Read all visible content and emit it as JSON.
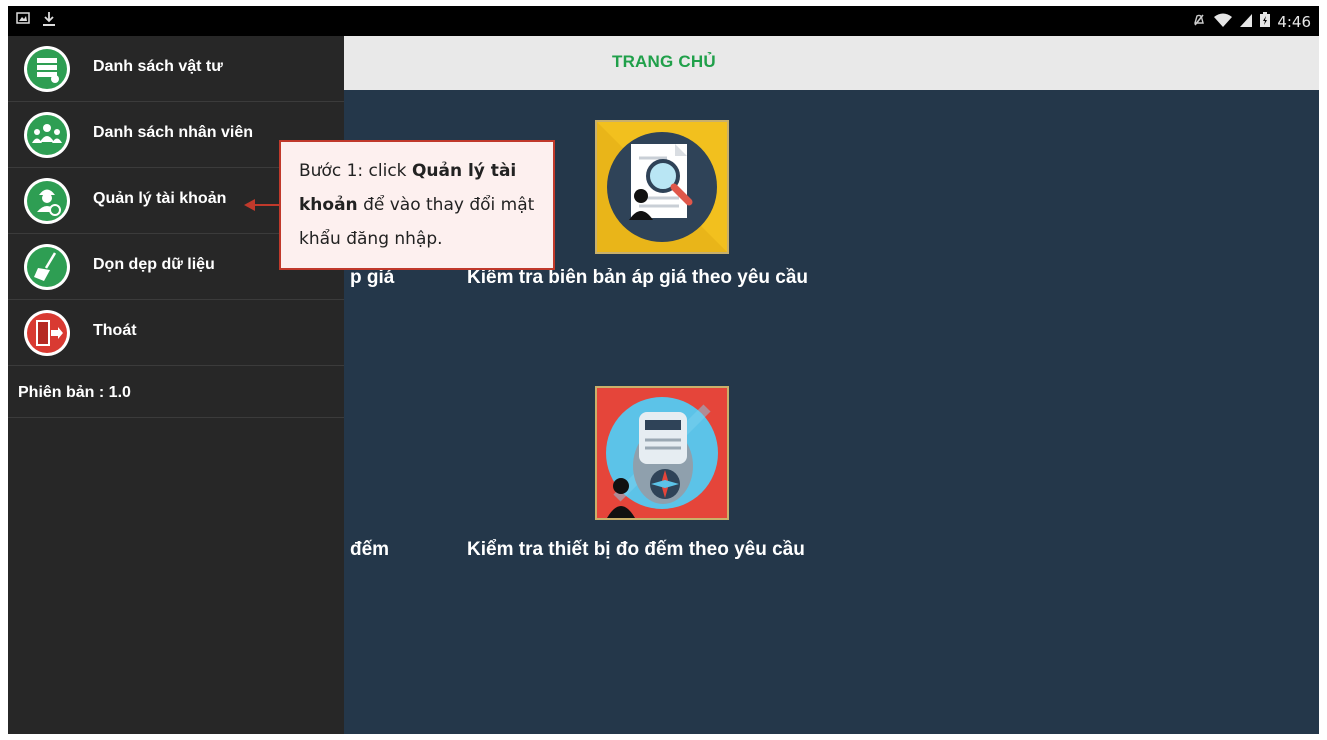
{
  "status_bar": {
    "time": "4:46"
  },
  "app_bar": {
    "title": "TRANG CHỦ"
  },
  "tiles": [
    {
      "label": "Kiểm tra biên bản áp giá theo yêu cầu",
      "icon": "document-search-icon"
    },
    {
      "label": "Kiểm tra thiết bị đo đếm theo yêu cầu",
      "icon": "electric-meter-icon"
    }
  ],
  "partial_labels": [
    "p giá",
    "đếm"
  ],
  "drawer": {
    "items": [
      {
        "label": "Danh sách vật tư",
        "icon": "materials-list-icon"
      },
      {
        "label": "Danh sách nhân viên",
        "icon": "staff-group-icon"
      },
      {
        "label": "Quản lý tài khoản",
        "icon": "account-settings-icon"
      },
      {
        "label": "Dọn dẹp dữ liệu",
        "icon": "broom-icon"
      },
      {
        "label": "Thoát",
        "icon": "exit-door-icon"
      }
    ],
    "version": "Phiên bản : 1.0"
  },
  "callout": {
    "prefix": "Bước 1: click ",
    "bold": "Quản lý tài khoản",
    "suffix": " để vào thay đổi mật khẩu đăng nhập."
  },
  "colors": {
    "accent": "#20a04a",
    "background": "#24374a",
    "drawer": "#272727",
    "callout_border": "#c0392b"
  }
}
